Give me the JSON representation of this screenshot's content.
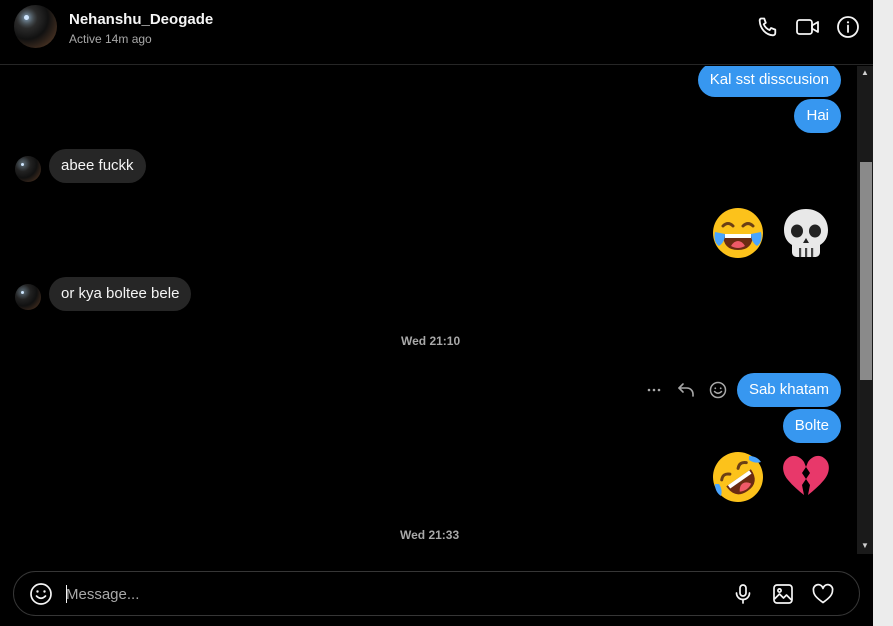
{
  "header": {
    "name": "Nehanshu_Deogade",
    "status": "Active 14m ago",
    "icons": [
      "phone-icon",
      "video-camera-icon",
      "info-icon"
    ]
  },
  "thread": {
    "messages": [
      {
        "direction": "outgoing",
        "type": "text",
        "text": "Kal sst disscusion"
      },
      {
        "direction": "outgoing",
        "type": "text",
        "text": "Hai"
      },
      {
        "direction": "incoming",
        "type": "text",
        "text": "abee fuckk"
      },
      {
        "direction": "outgoing",
        "type": "emoji",
        "emoji": [
          "face-with-tears-of-joy",
          "skull"
        ]
      },
      {
        "direction": "incoming",
        "type": "text",
        "text": "or kya boltee bele"
      },
      {
        "type": "timestamp",
        "text": "Wed 21:10"
      },
      {
        "direction": "outgoing",
        "type": "text",
        "text": "Sab khatam"
      },
      {
        "direction": "outgoing",
        "type": "text",
        "text": "Bolte"
      },
      {
        "direction": "outgoing",
        "type": "emoji",
        "emoji": [
          "rolling-on-the-floor-laughing",
          "broken-heart"
        ]
      },
      {
        "type": "timestamp",
        "text": "Wed 21:33"
      }
    ],
    "hover_tools": [
      "more-options-icon",
      "reply-icon",
      "react-emoji-icon"
    ]
  },
  "composer": {
    "placeholder": "Message...",
    "value": "",
    "icons": [
      "emoji-picker-icon",
      "microphone-icon",
      "image-icon",
      "heart-icon"
    ]
  },
  "colors": {
    "background": "#000000",
    "outgoing_bubble": "#3797f0",
    "incoming_bubble": "#262626",
    "secondary_text": "#a8a8a8"
  }
}
